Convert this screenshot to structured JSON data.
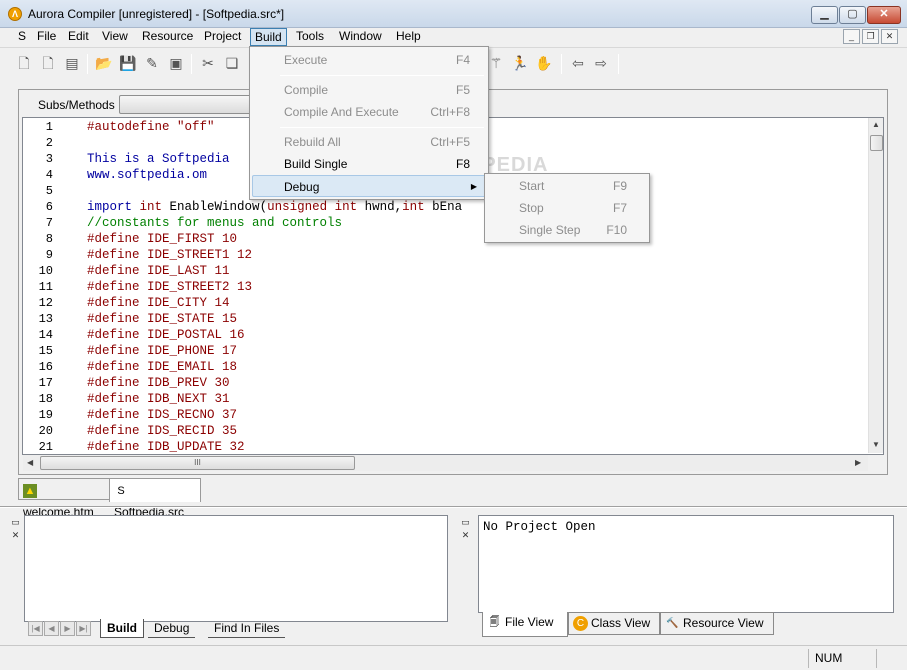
{
  "window": {
    "title": "Aurora Compiler [unregistered] - [Softpedia.src*]",
    "app_icon_glyph": "Λ"
  },
  "menubar": {
    "items": [
      {
        "label": "File"
      },
      {
        "label": "Edit"
      },
      {
        "label": "View"
      },
      {
        "label": "Resource"
      },
      {
        "label": "Project"
      },
      {
        "label": "Build"
      },
      {
        "label": "Tools"
      },
      {
        "label": "Window"
      },
      {
        "label": "Help"
      }
    ],
    "doc_icon_glyph": "S",
    "active_menu": "Build"
  },
  "build_menu": {
    "items": [
      {
        "label": "Execute",
        "shortcut": "F4",
        "enabled": false
      },
      {
        "label": "Compile",
        "shortcut": "F5",
        "enabled": false
      },
      {
        "label": "Compile And Execute",
        "shortcut": "Ctrl+F8",
        "enabled": false
      },
      {
        "label": "Rebuild All",
        "shortcut": "Ctrl+F5",
        "enabled": false
      },
      {
        "label": "Build Single",
        "shortcut": "F8",
        "enabled": true
      },
      {
        "label": "Debug",
        "shortcut": "",
        "enabled": true,
        "submenu": true
      }
    ]
  },
  "debug_menu": {
    "items": [
      {
        "label": "Start",
        "shortcut": "F9"
      },
      {
        "label": "Stop",
        "shortcut": "F7"
      },
      {
        "label": "Single Step",
        "shortcut": "F10"
      }
    ]
  },
  "editor": {
    "subs_label": "Subs/Methods",
    "lines": [
      {
        "n": "1",
        "text": "#autodefine \"off\""
      },
      {
        "n": "2",
        "text": ""
      },
      {
        "n": "3",
        "text": "This is a Softpedia"
      },
      {
        "n": "4",
        "text": "www.softpedia.om"
      },
      {
        "n": "5",
        "text": ""
      },
      {
        "n": "6",
        "text": "import int EnableWindow(unsigned int hwnd,int bEna"
      },
      {
        "n": "7",
        "text": "//constants for menus and controls"
      },
      {
        "n": "8",
        "text": "#define IDE_FIRST 10"
      },
      {
        "n": "9",
        "text": "#define IDE_STREET1 12"
      },
      {
        "n": "10",
        "text": "#define IDE_LAST 11"
      },
      {
        "n": "11",
        "text": "#define IDE_STREET2 13"
      },
      {
        "n": "12",
        "text": "#define IDE_CITY 14"
      },
      {
        "n": "13",
        "text": "#define IDE_STATE 15"
      },
      {
        "n": "14",
        "text": "#define IDE_POSTAL 16"
      },
      {
        "n": "15",
        "text": "#define IDE_PHONE 17"
      },
      {
        "n": "16",
        "text": "#define IDE_EMAIL 18"
      },
      {
        "n": "17",
        "text": "#define IDB_PREV 30"
      },
      {
        "n": "18",
        "text": "#define IDB_NEXT 31"
      },
      {
        "n": "19",
        "text": "#define IDS_RECNO 37"
      },
      {
        "n": "20",
        "text": "#define IDS_RECID 35"
      },
      {
        "n": "21",
        "text": "#define IDB_UPDATE 32"
      }
    ]
  },
  "doc_tabs": [
    {
      "label": "welcome.htm",
      "icon": "image-icon",
      "selected": false
    },
    {
      "label": "Softpedia.src",
      "icon": "source-file-icon",
      "selected": true
    }
  ],
  "output_tabs": [
    {
      "label": "Build",
      "selected": true
    },
    {
      "label": "Debug",
      "selected": false
    },
    {
      "label": "Find In Files",
      "selected": false
    }
  ],
  "project": {
    "message": "No Project Open",
    "tabs": [
      {
        "label": "File View",
        "icon": "file-view-icon",
        "selected": true
      },
      {
        "label": "Class View",
        "icon": "class-view-icon",
        "selected": false
      },
      {
        "label": "Resource View",
        "icon": "resource-view-icon",
        "selected": false
      }
    ]
  },
  "statusbar": {
    "num": "NUM"
  },
  "watermark": "SOFTPEDIA",
  "colors": {
    "keyword_red": "#8b0000",
    "keyword_blue": "#0000a0",
    "comment_green": "#008000",
    "menu_highlight": "#dbe9f5"
  }
}
